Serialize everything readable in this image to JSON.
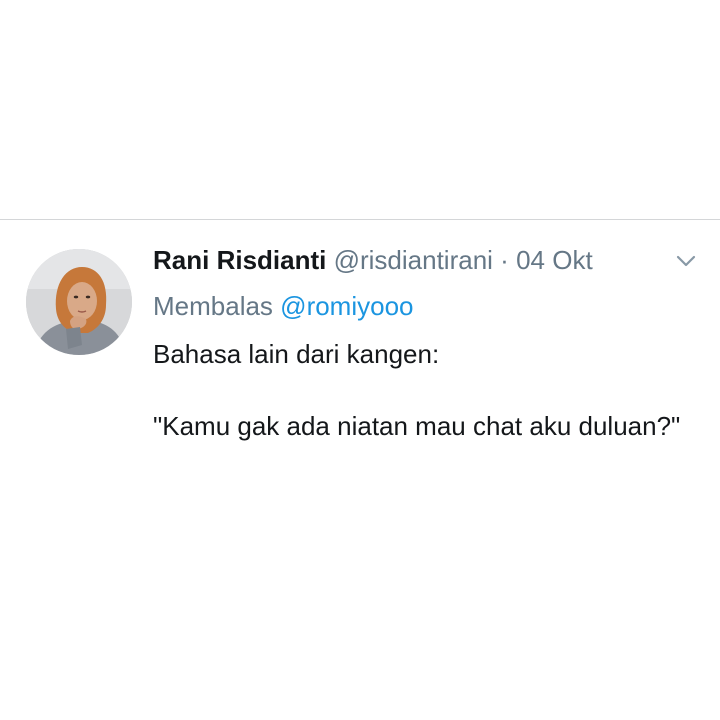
{
  "tweet": {
    "author_name": "Rani Risdianti",
    "handle": "@risdiantirani",
    "separator": "·",
    "date": "04 Okt",
    "reply_prefix": "Membalas",
    "reply_to": "@romiyooo",
    "text_lines": [
      "Bahasa lain dari kangen:",
      "\"Kamu gak ada niatan mau chat aku duluan?\""
    ]
  },
  "colors": {
    "name": "#14171a",
    "meta": "#657786",
    "link": "#1b95e0",
    "divider": "#d4d6d8",
    "hijab": "#c6783a"
  },
  "icons": {
    "avatar": "profile-photo",
    "caret": "chevron-down-icon"
  }
}
